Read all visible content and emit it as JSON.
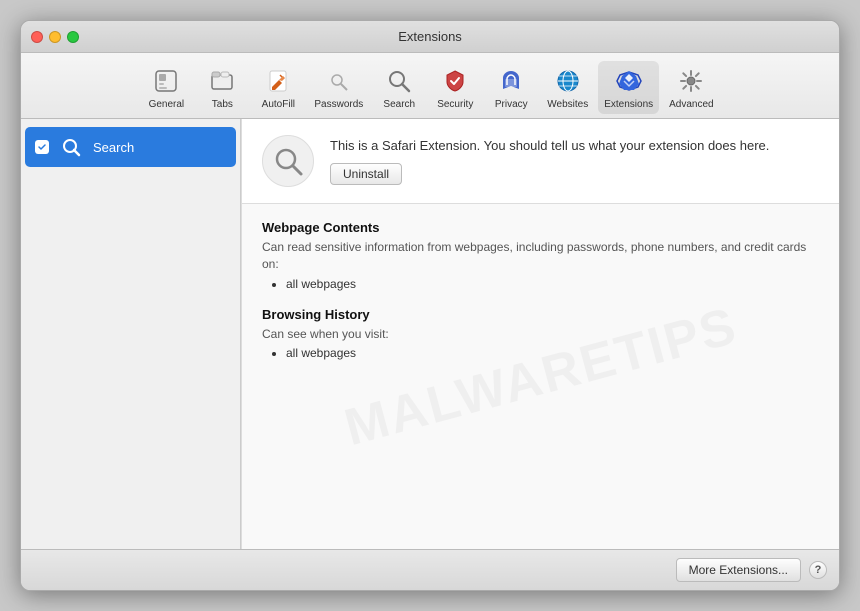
{
  "window": {
    "title": "Extensions",
    "buttons": {
      "close": "close",
      "minimize": "minimize",
      "maximize": "maximize"
    }
  },
  "toolbar": {
    "items": [
      {
        "id": "general",
        "label": "General",
        "icon": "⊟"
      },
      {
        "id": "tabs",
        "label": "Tabs",
        "icon": "▭"
      },
      {
        "id": "autofill",
        "label": "AutoFill",
        "icon": "✏️"
      },
      {
        "id": "passwords",
        "label": "Passwords",
        "icon": "🔑"
      },
      {
        "id": "search",
        "label": "Search",
        "icon": "🔍"
      },
      {
        "id": "security",
        "label": "Security",
        "icon": "🛡"
      },
      {
        "id": "privacy",
        "label": "Privacy",
        "icon": "✋"
      },
      {
        "id": "websites",
        "label": "Websites",
        "icon": "🌐"
      },
      {
        "id": "extensions",
        "label": "Extensions",
        "icon": "⚡"
      },
      {
        "id": "advanced",
        "label": "Advanced",
        "icon": "⚙"
      }
    ],
    "active": "extensions"
  },
  "sidebar": {
    "items": [
      {
        "id": "search-ext",
        "label": "Search",
        "enabled": true,
        "selected": true
      }
    ]
  },
  "content": {
    "extension": {
      "name": "Search",
      "description": "This is a Safari Extension. You should tell us what your extension does here.",
      "uninstall_label": "Uninstall"
    },
    "permissions": {
      "sections": [
        {
          "id": "webpage-contents",
          "title": "Webpage Contents",
          "description": "Can read sensitive information from webpages, including passwords, phone numbers, and credit cards on:",
          "items": [
            "all webpages"
          ]
        },
        {
          "id": "browsing-history",
          "title": "Browsing History",
          "description": "Can see when you visit:",
          "items": [
            "all webpages"
          ]
        }
      ]
    },
    "watermark": "MALWARETIPS"
  },
  "footer": {
    "more_extensions_label": "More Extensions...",
    "help_label": "?"
  }
}
